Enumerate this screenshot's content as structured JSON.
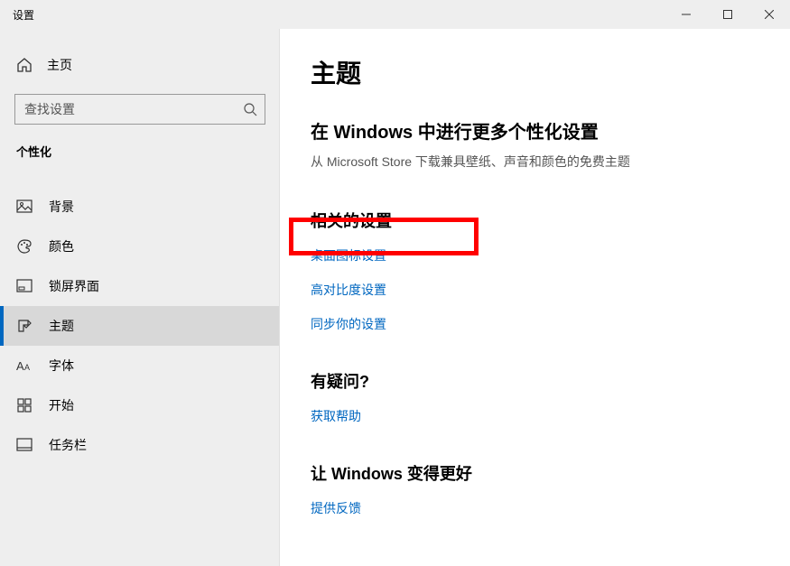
{
  "window": {
    "title": "设置"
  },
  "sidebar": {
    "home": "主页",
    "search_placeholder": "查找设置",
    "section": "个性化",
    "items": [
      {
        "label": "背景"
      },
      {
        "label": "颜色"
      },
      {
        "label": "锁屏界面"
      },
      {
        "label": "主题"
      },
      {
        "label": "字体"
      },
      {
        "label": "开始"
      },
      {
        "label": "任务栏"
      }
    ]
  },
  "main": {
    "title": "主题",
    "more_title": "在 Windows 中进行更多个性化设置",
    "more_sub": "从 Microsoft Store 下载兼具壁纸、声音和颜色的免费主题",
    "related_title": "相关的设置",
    "links": {
      "desktop_icons": "桌面图标设置",
      "high_contrast": "高对比度设置",
      "sync": "同步你的设置"
    },
    "question_title": "有疑问?",
    "get_help": "获取帮助",
    "better_title": "让 Windows 变得更好",
    "feedback": "提供反馈"
  }
}
